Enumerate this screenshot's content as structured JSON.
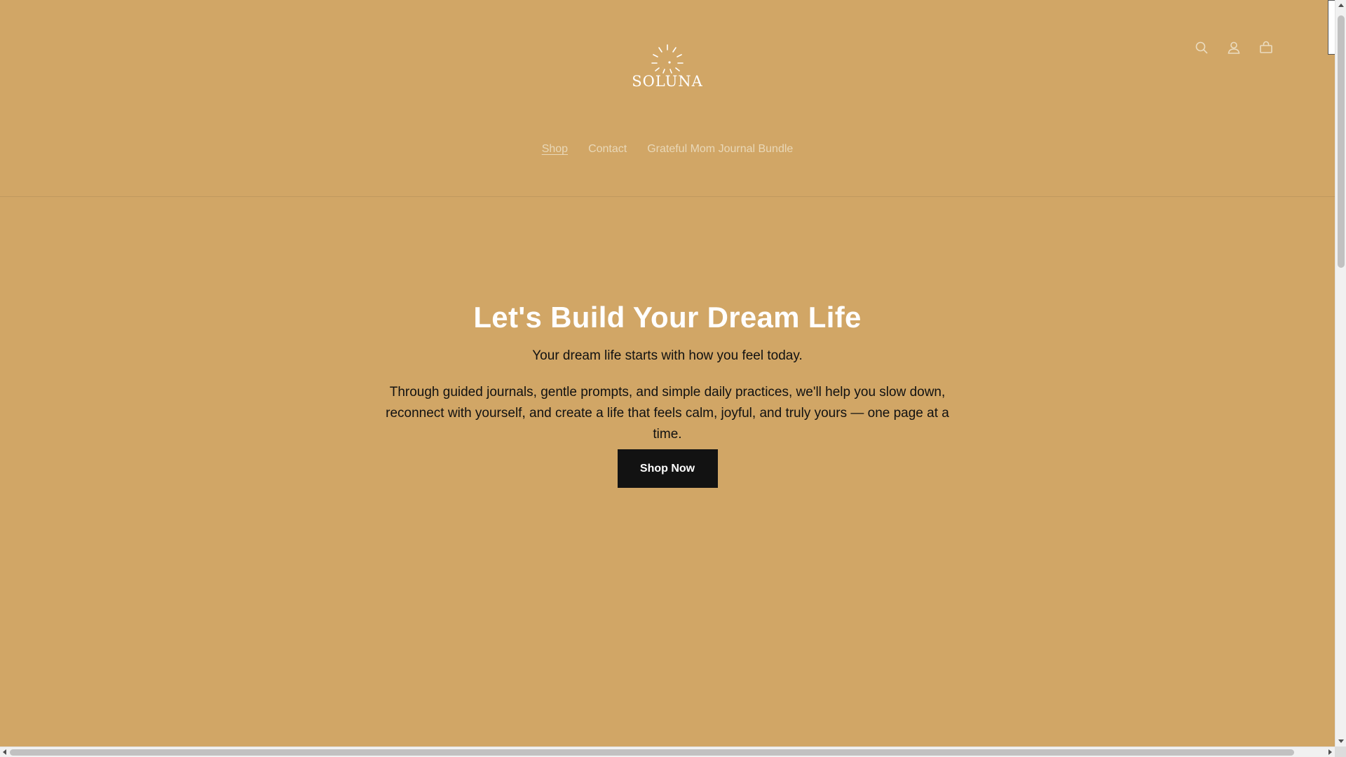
{
  "brand": {
    "logo_text": "SOLUNA"
  },
  "header": {
    "icons": [
      "search-icon",
      "account-icon",
      "cart-icon"
    ]
  },
  "nav": {
    "items": [
      {
        "label": "Shop",
        "active": true
      },
      {
        "label": "Contact",
        "active": false
      },
      {
        "label": "Grateful Mom Journal Bundle",
        "active": false
      }
    ]
  },
  "hero": {
    "title": "Let's Build Your Dream Life",
    "subtitle": "Your dream life starts with how you feel today.",
    "body": "Through guided journals, gentle prompts, and simple daily practices, we'll help you slow down, reconnect with yourself, and create a life that feels calm, joyful, and truly yours — one page at a time.",
    "cta_label": "Shop Now"
  },
  "colors": {
    "background": "#d1a666",
    "nav_link": "#e9d8b8",
    "button_bg": "#121212",
    "title": "#ffffff"
  }
}
